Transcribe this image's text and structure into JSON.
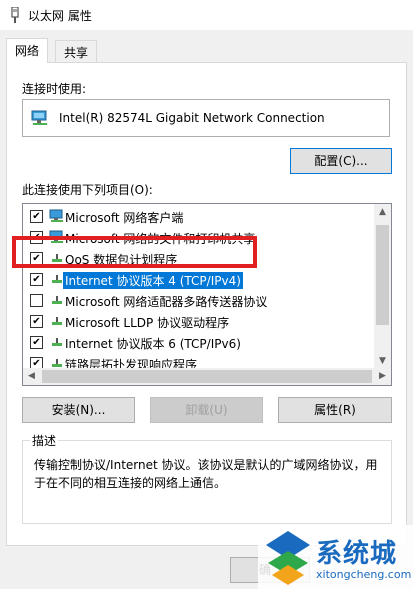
{
  "window": {
    "title": "以太网 属性"
  },
  "tabs": [
    {
      "label": "网络"
    },
    {
      "label": "共享"
    }
  ],
  "connection": {
    "label": "连接时使用:",
    "adapter_name": "Intel(R) 82574L Gigabit Network Connection",
    "configure_button": "配置(C)..."
  },
  "items": {
    "label": "此连接使用下列项目(O):",
    "list": [
      {
        "label": "Microsoft 网络客户端",
        "checked": true,
        "icon": "network-client-icon"
      },
      {
        "label": "Microsoft 网络的文件和打印机共享",
        "checked": true,
        "icon": "file-printer-sharing-icon"
      },
      {
        "label": "QoS 数据包计划程序",
        "checked": true,
        "icon": "qos-icon"
      },
      {
        "label": "Internet 协议版本 4 (TCP/IPv4)",
        "checked": true,
        "icon": "protocol-icon",
        "selected": true
      },
      {
        "label": "Microsoft 网络适配器多路传送器协议",
        "checked": false,
        "icon": "protocol-icon"
      },
      {
        "label": "Microsoft LLDP 协议驱动程序",
        "checked": true,
        "icon": "protocol-icon"
      },
      {
        "label": "Internet 协议版本 6 (TCP/IPv6)",
        "checked": true,
        "icon": "protocol-icon"
      },
      {
        "label": "链路层拓扑发现响应程序",
        "checked": true,
        "icon": "protocol-icon"
      }
    ]
  },
  "buttons": {
    "install": "安装(N)...",
    "uninstall": "卸载(U)",
    "properties": "属性(R)",
    "ok_partial": "确"
  },
  "description": {
    "title": "描述",
    "text": "传输控制协议/Internet 协议。该协议是默认的广域网络协议，用于在不同的相互连接的网络上通信。"
  },
  "watermark": {
    "text": "系统城",
    "sub": "xitongcheng.com"
  },
  "colors": {
    "selection": "#0078d7",
    "highlight_border": "#e02020",
    "watermark": "#1a6bbf"
  }
}
